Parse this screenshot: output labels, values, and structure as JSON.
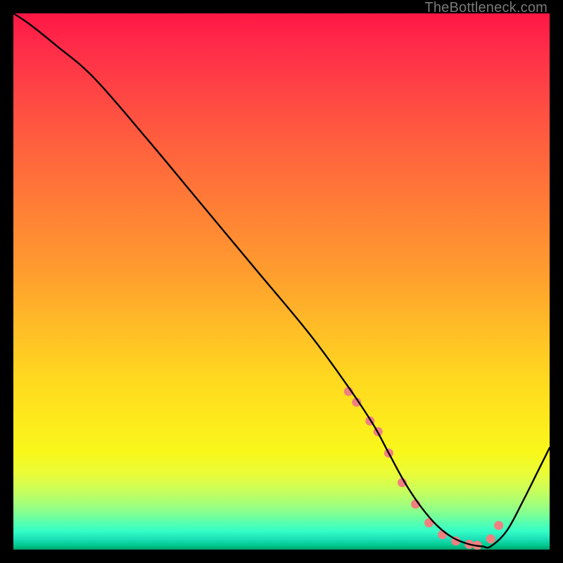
{
  "watermark": "TheBottleneck.com",
  "chart_data": {
    "type": "line",
    "title": "",
    "xlabel": "",
    "ylabel": "",
    "xlim": [
      0,
      100
    ],
    "ylim": [
      0,
      100
    ],
    "series": [
      {
        "name": "curve",
        "x": [
          0,
          3,
          8,
          15,
          25,
          35,
          45,
          55,
          62,
          67,
          70,
          73,
          76,
          79,
          82,
          85,
          87.5,
          89,
          92,
          95,
          98,
          100
        ],
        "y": [
          100,
          98,
          94,
          88,
          76.5,
          64.5,
          52.5,
          40.5,
          31,
          23.5,
          18,
          12.5,
          8,
          4.5,
          2.2,
          1,
          0.6,
          0.6,
          3.5,
          9,
          15,
          19
        ],
        "color": "#000000"
      }
    ],
    "markers": {
      "name": "dots",
      "x": [
        62.5,
        64,
        66.5,
        68,
        70,
        72.5,
        75,
        77.5,
        80,
        82.5,
        85,
        86.5,
        89,
        90.5
      ],
      "y": [
        29.5,
        27.5,
        24,
        22,
        18,
        12.5,
        8.5,
        5,
        2.8,
        1.6,
        1,
        0.8,
        2,
        4.5
      ],
      "color": "#f08080",
      "radius": 6.5
    }
  }
}
